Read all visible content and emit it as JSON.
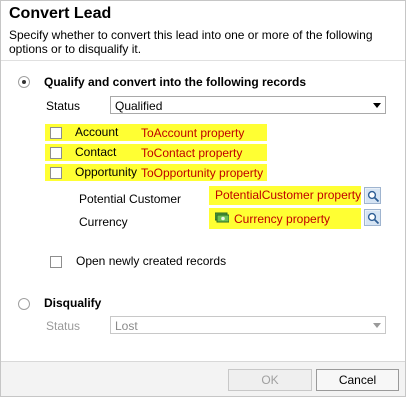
{
  "dialog": {
    "title": "Convert Lead",
    "subtitle": "Specify whether to convert this lead into one or more of the following options or to disqualify it."
  },
  "qualify": {
    "label": "Qualify and convert into the following records",
    "selected": true,
    "status_label": "Status",
    "status_value": "Qualified",
    "options": [
      {
        "label": "Account",
        "checked": false,
        "annotation": "ToAccount property"
      },
      {
        "label": "Contact",
        "checked": false,
        "annotation": "ToContact property"
      },
      {
        "label": "Opportunity",
        "checked": false,
        "annotation": "ToOpportunity property"
      }
    ],
    "potential_customer_label": "Potential Customer",
    "potential_customer_annotation": "PotentialCustomer property",
    "currency_label": "Currency",
    "currency_annotation": "Currency property",
    "open_records_label": "Open newly created records",
    "open_records_checked": false
  },
  "disqualify": {
    "label": "Disqualify",
    "selected": false,
    "status_label": "Status",
    "status_value": "Lost"
  },
  "footer": {
    "ok_label": "OK",
    "cancel_label": "Cancel"
  },
  "colors": {
    "highlight": "#ffff33",
    "annotation_text": "#c00000",
    "footer_bg": "#f3f3f3"
  }
}
